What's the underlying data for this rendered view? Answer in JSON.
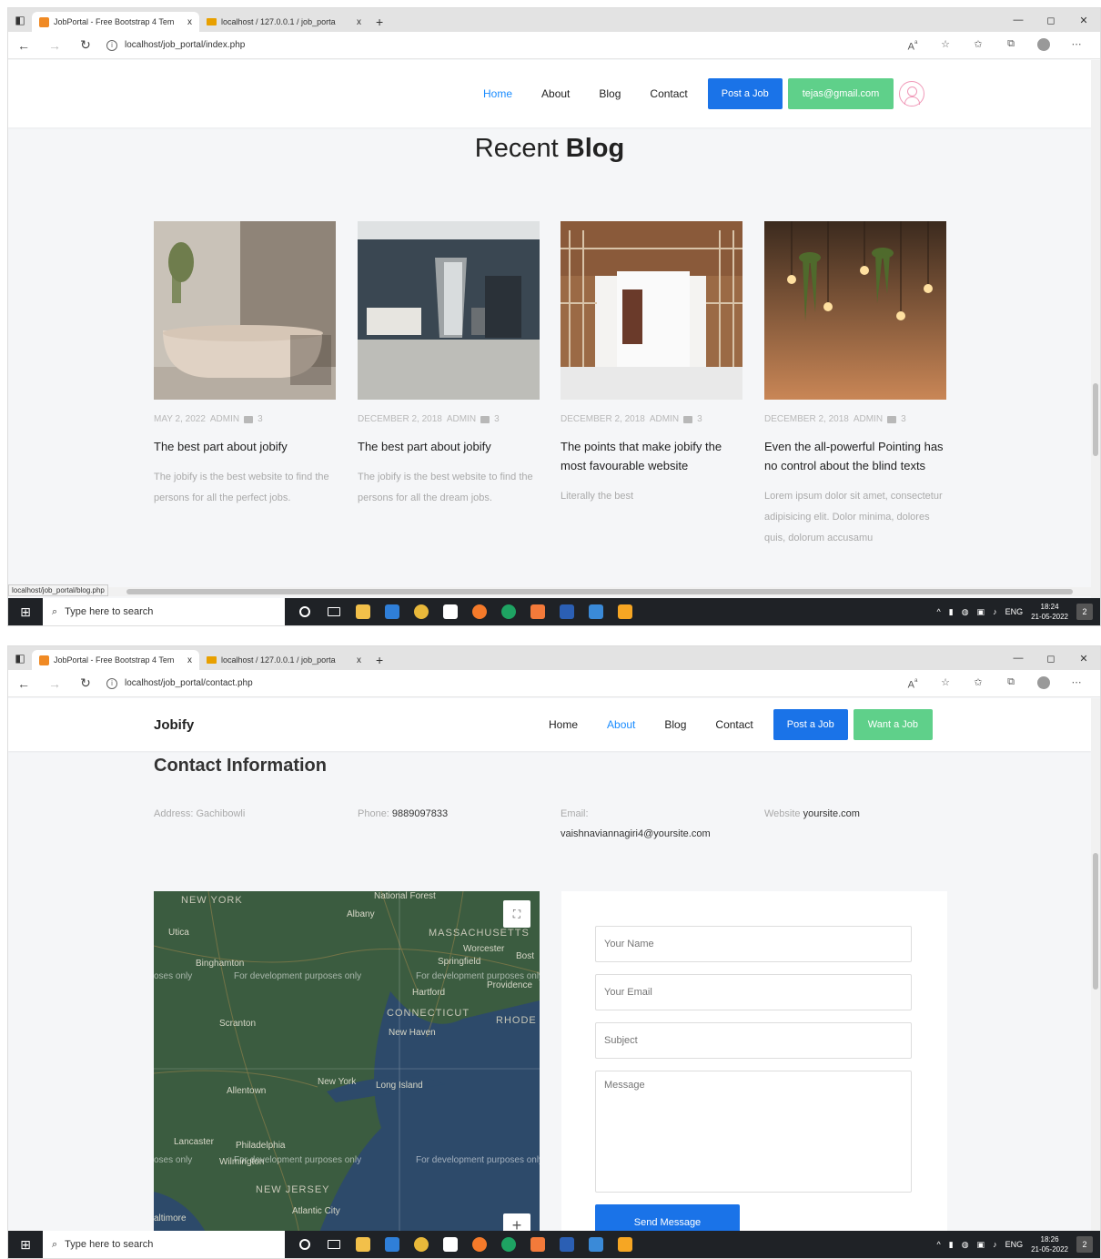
{
  "shot1": {
    "browser": {
      "tabs": [
        {
          "title": "JobPortal - Free Bootstrap 4 Tem",
          "close": "x"
        },
        {
          "title": "localhost / 127.0.0.1 / job_porta",
          "close": "x"
        }
      ],
      "new_tab": "+",
      "url": "localhost/job_portal/index.php",
      "window_controls": [
        "—",
        "◻",
        "✕"
      ]
    },
    "header": {
      "menu": [
        "Home",
        "About",
        "Blog",
        "Contact"
      ],
      "active": "Home",
      "post_job": "Post a Job",
      "user_email": "tejas@gmail.com"
    },
    "blog": {
      "title_light": "Recent ",
      "title_bold": "Blog",
      "posts": [
        {
          "date": "MAY 2, 2022",
          "author": "ADMIN",
          "comments": "3",
          "title": "The best part about jobify",
          "excerpt": "The jobify is the best website to find the persons for all the perfect jobs."
        },
        {
          "date": "DECEMBER 2, 2018",
          "author": "ADMIN",
          "comments": "3",
          "title": "The best part about jobify",
          "excerpt": "The jobify is the best website to find the persons for all the dream jobs."
        },
        {
          "date": "DECEMBER 2, 2018",
          "author": "ADMIN",
          "comments": "3",
          "title": "The points that make jobify the most favourable website",
          "excerpt": "Literally the best"
        },
        {
          "date": "DECEMBER 2, 2018",
          "author": "ADMIN",
          "comments": "3",
          "title": "Even the all-powerful Pointing has no control about the blind texts",
          "excerpt": "Lorem ipsum dolor sit amet, consectetur adipisicing elit. Dolor minima, dolores quis, dolorum accusamu"
        }
      ]
    },
    "status_url": "localhost/job_portal/blog.php",
    "taskbar": {
      "search_placeholder": "Type here to search",
      "lang": "ENG",
      "time": "18:24",
      "date": "21-05-2022",
      "notifications": "2"
    }
  },
  "shot2": {
    "browser": {
      "tabs": [
        {
          "title": "JobPortal - Free Bootstrap 4 Tem",
          "close": "x"
        },
        {
          "title": "localhost / 127.0.0.1 / job_porta",
          "close": "x"
        }
      ],
      "new_tab": "+",
      "url": "localhost/job_portal/contact.php",
      "window_controls": [
        "—",
        "◻",
        "✕"
      ]
    },
    "header": {
      "brand": "Jobify",
      "menu": [
        "Home",
        "About",
        "Blog",
        "Contact"
      ],
      "active": "About",
      "post_job": "Post a Job",
      "want_job": "Want a Job"
    },
    "contact": {
      "title": "Contact Information",
      "address_label": "Address: ",
      "address": "Gachibowli",
      "phone_label": "Phone: ",
      "phone": "9889097833",
      "email_label": "Email:",
      "email": "vaishnaviannagiri4@yoursite.com",
      "website_label": "Website ",
      "website": "yoursite.com"
    },
    "map": {
      "labels": [
        "NEW YORK",
        "MASSACHUSETTS",
        "CONNECTICUT",
        "RHODE ISLAND",
        "NEW JERSEY",
        "Albany",
        "Worcester",
        "Bost",
        "Springfield",
        "Hartford",
        "Providence",
        "New Haven",
        "Binghamton",
        "New York",
        "Long Island",
        "Philadelphia",
        "Allentown",
        "Wilmington",
        "Lancaster",
        "altimore",
        "Scranton",
        "Utica",
        "National Forest",
        "Atlantic City"
      ],
      "dev_text": "For development purposes only",
      "dev_fragment": "oses only",
      "zoom_in": "+",
      "fullscreen": "⛶"
    },
    "form": {
      "name_placeholder": "Your Name",
      "email_placeholder": "Your Email",
      "subject_placeholder": "Subject",
      "message_placeholder": "Message",
      "submit": "Send Message"
    },
    "taskbar": {
      "search_placeholder": "Type here to search",
      "lang": "ENG",
      "time": "18:26",
      "date": "21-05-2022",
      "notifications": "2"
    }
  }
}
